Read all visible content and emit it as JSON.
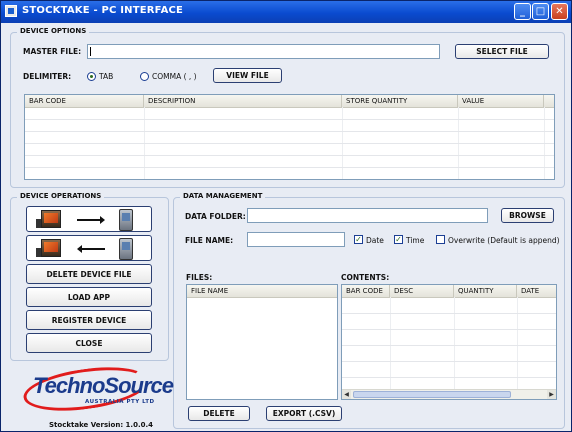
{
  "window": {
    "title": "STOCKTAKE - PC INTERFACE"
  },
  "device_options": {
    "legend": "DEVICE OPTIONS",
    "master_file_label": "MASTER FILE:",
    "master_file_value": "",
    "select_file_label": "SELECT FILE",
    "delimiter_label": "DELIMITER:",
    "delimiter_options": [
      {
        "label": "TAB",
        "selected": true
      },
      {
        "label": "COMMA ( , )",
        "selected": false
      }
    ],
    "view_file_label": "VIEW FILE",
    "table_columns": [
      "BAR CODE",
      "DESCRIPTION",
      "STORE QUANTITY",
      "VALUE"
    ]
  },
  "device_operations": {
    "legend": "DEVICE OPERATIONS",
    "transfer_buttons": [
      {
        "icon": "pc-to-device-transfer-icon",
        "direction": "right"
      },
      {
        "icon": "device-to-pc-transfer-icon",
        "direction": "left"
      }
    ],
    "buttons": [
      "DELETE DEVICE FILE",
      "LOAD APP",
      "REGISTER DEVICE",
      "CLOSE"
    ]
  },
  "data_management": {
    "legend": "DATA MANAGEMENT",
    "data_folder_label": "DATA FOLDER:",
    "data_folder_value": "",
    "browse_label": "BROWSE",
    "file_name_label": "FILE NAME:",
    "file_name_value": "",
    "checkboxes": [
      {
        "label": "Date",
        "checked": true
      },
      {
        "label": "Time",
        "checked": true
      },
      {
        "label": "Overwrite (Default is append)",
        "checked": false
      }
    ],
    "files_label": "FILES:",
    "files_columns": [
      "FILE NAME"
    ],
    "contents_label": "CONTENTS:",
    "contents_columns": [
      "BAR CODE",
      "DESC",
      "QUANTITY",
      "DATE"
    ],
    "delete_label": "DELETE",
    "export_label": "EXPORT (.CSV)"
  },
  "footer": {
    "logo_text_1": "Techno",
    "logo_text_2": "Source",
    "logo_sub": "AUSTRALIA PTY LTD",
    "version": "Stocktake Version: 1.0.0.4"
  },
  "colors": {
    "titlebar": "#0a4bd0",
    "logo_blue": "#1b3b8c",
    "logo_red": "#e11c1c",
    "window_bg": "#e8ecf4"
  }
}
